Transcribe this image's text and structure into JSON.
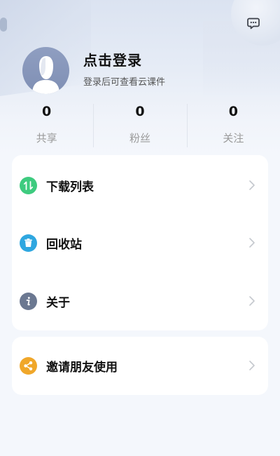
{
  "profile": {
    "title": "点击登录",
    "subtitle": "登录后可查看云课件"
  },
  "stats": [
    {
      "value": "0",
      "label": "共享"
    },
    {
      "value": "0",
      "label": "粉丝"
    },
    {
      "value": "0",
      "label": "关注"
    }
  ],
  "menu": [
    {
      "label": "下载列表",
      "icon": "download-list-icon",
      "color": "#3ecb7f"
    },
    {
      "label": "回收站",
      "icon": "recycle-bin-icon",
      "color": "#2fa7e0"
    },
    {
      "label": "关于",
      "icon": "info-icon",
      "color": "#6b7891"
    }
  ],
  "invite": {
    "label": "邀请朋友使用",
    "icon": "share-icon",
    "color": "#f0a72a"
  },
  "icons": {
    "message": "message-icon",
    "avatar": "avatar-icon",
    "chevron": "chevron-right-icon"
  }
}
